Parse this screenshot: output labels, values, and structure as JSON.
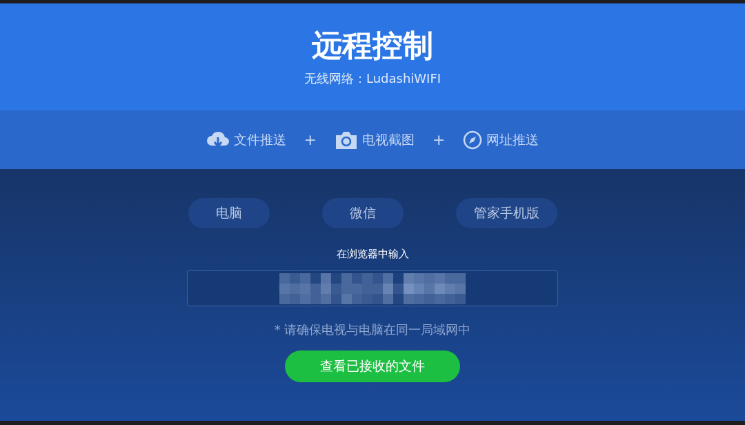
{
  "header": {
    "title": "远程控制",
    "network": "无线网络：LudashiWIFI"
  },
  "features": [
    {
      "kind": "cloud",
      "label": "文件推送"
    },
    {
      "kind": "plus",
      "label": "+"
    },
    {
      "kind": "camera",
      "label": "电视截图"
    },
    {
      "kind": "plus",
      "label": "+"
    },
    {
      "kind": "compass",
      "label": "网址推送"
    }
  ],
  "modes": [
    "电脑",
    "微信",
    "管家手机版"
  ],
  "prompt": "在浏览器中输入",
  "address": {
    "kind": "pixelated"
  },
  "note": "* 请确保电视与电脑在同一局域网中",
  "action": "查看已接收的文件"
}
